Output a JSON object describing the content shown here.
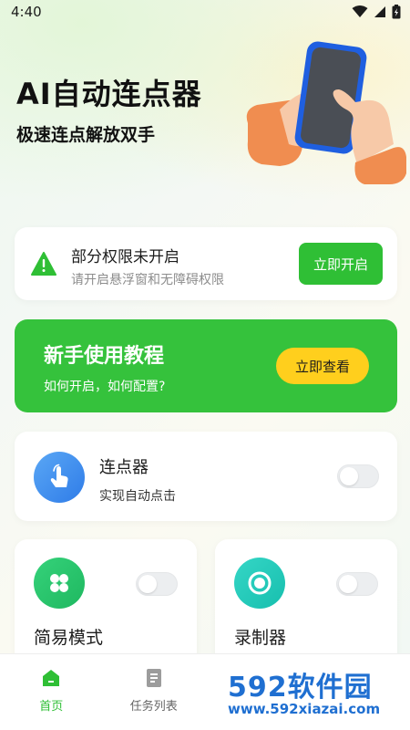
{
  "status_bar": {
    "time": "4:40"
  },
  "hero": {
    "title": "AI自动连点器",
    "subtitle": "极速连点解放双手"
  },
  "permission": {
    "title": "部分权限未开启",
    "subtitle": "请开启悬浮窗和无障碍权限",
    "button": "立即开启"
  },
  "tutorial": {
    "title": "新手使用教程",
    "subtitle": "如何开启，如何配置?",
    "button": "立即查看"
  },
  "clicker": {
    "title": "连点器",
    "subtitle": "实现自动点击",
    "enabled": false
  },
  "modes": [
    {
      "title": "简易模式",
      "icon": "grid-icon",
      "enabled": false
    },
    {
      "title": "录制器",
      "icon": "record-icon",
      "enabled": false
    }
  ],
  "nav": [
    {
      "label": "首页",
      "icon": "home-icon",
      "active": true
    },
    {
      "label": "任务列表",
      "icon": "task-list-icon",
      "active": false
    }
  ],
  "watermark": {
    "brand": "592软件园",
    "url": "www.592xiazai.com"
  },
  "colors": {
    "accent": "#2fbf35",
    "button_yellow": "#ffcf1d",
    "icon_blue": "#2f7ce8",
    "icon_teal": "#17bfae"
  }
}
